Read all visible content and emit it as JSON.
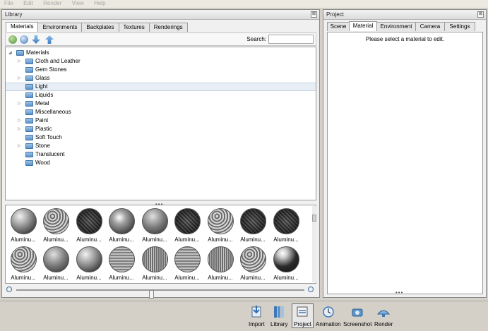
{
  "menu": {
    "items": [
      "File",
      "Edit",
      "Render",
      "View",
      "Help"
    ]
  },
  "library": {
    "title": "Library",
    "close_glyph": "⊠",
    "tabs": [
      "Materials",
      "Environments",
      "Backplates",
      "Textures",
      "Renderings"
    ],
    "search_label": "Search:",
    "search_value": "",
    "tree": {
      "root": "Materials",
      "items": [
        {
          "label": "Cloth and Leather",
          "expandable": true
        },
        {
          "label": "Gem Stones",
          "expandable": false
        },
        {
          "label": "Glass",
          "expandable": true
        },
        {
          "label": "Light",
          "expandable": false,
          "selected": true
        },
        {
          "label": "Liquids",
          "expandable": false
        },
        {
          "label": "Metal",
          "expandable": true
        },
        {
          "label": "Miscellaneous",
          "expandable": false
        },
        {
          "label": "Paint",
          "expandable": true
        },
        {
          "label": "Plastic",
          "expandable": true
        },
        {
          "label": "Soft Touch",
          "expandable": false
        },
        {
          "label": "Stone",
          "expandable": true
        },
        {
          "label": "Translucent",
          "expandable": false
        },
        {
          "label": "Wood",
          "expandable": false
        }
      ]
    },
    "splitter_glyph": "•••",
    "thumbnails": {
      "label": "Aluminu...",
      "row1": [
        "sp0",
        "sp1",
        "sp2",
        "sp3",
        "sp4",
        "sp2",
        "sp1",
        "sp2",
        "sp2"
      ],
      "row2": [
        "sp1",
        "sp4",
        "sp0",
        "sp5",
        "sp6",
        "sp5",
        "sp6",
        "sp1",
        "sp7"
      ]
    }
  },
  "project": {
    "title": "Project",
    "close_glyph": "⊠",
    "tabs": [
      "Scene",
      "Material",
      "Environment",
      "Camera",
      "Settings"
    ],
    "message": "Please select a material to edit.",
    "splitter_glyph": "•••"
  },
  "bottom_toolbar": {
    "items": [
      {
        "label": "Import",
        "icon": "import-icon"
      },
      {
        "label": "Library",
        "icon": "library-icon"
      },
      {
        "label": "Project",
        "icon": "project-icon"
      },
      {
        "label": "Animation",
        "icon": "animation-icon"
      },
      {
        "label": "Screenshot",
        "icon": "screenshot-icon"
      },
      {
        "label": "Render",
        "icon": "render-icon"
      }
    ]
  }
}
